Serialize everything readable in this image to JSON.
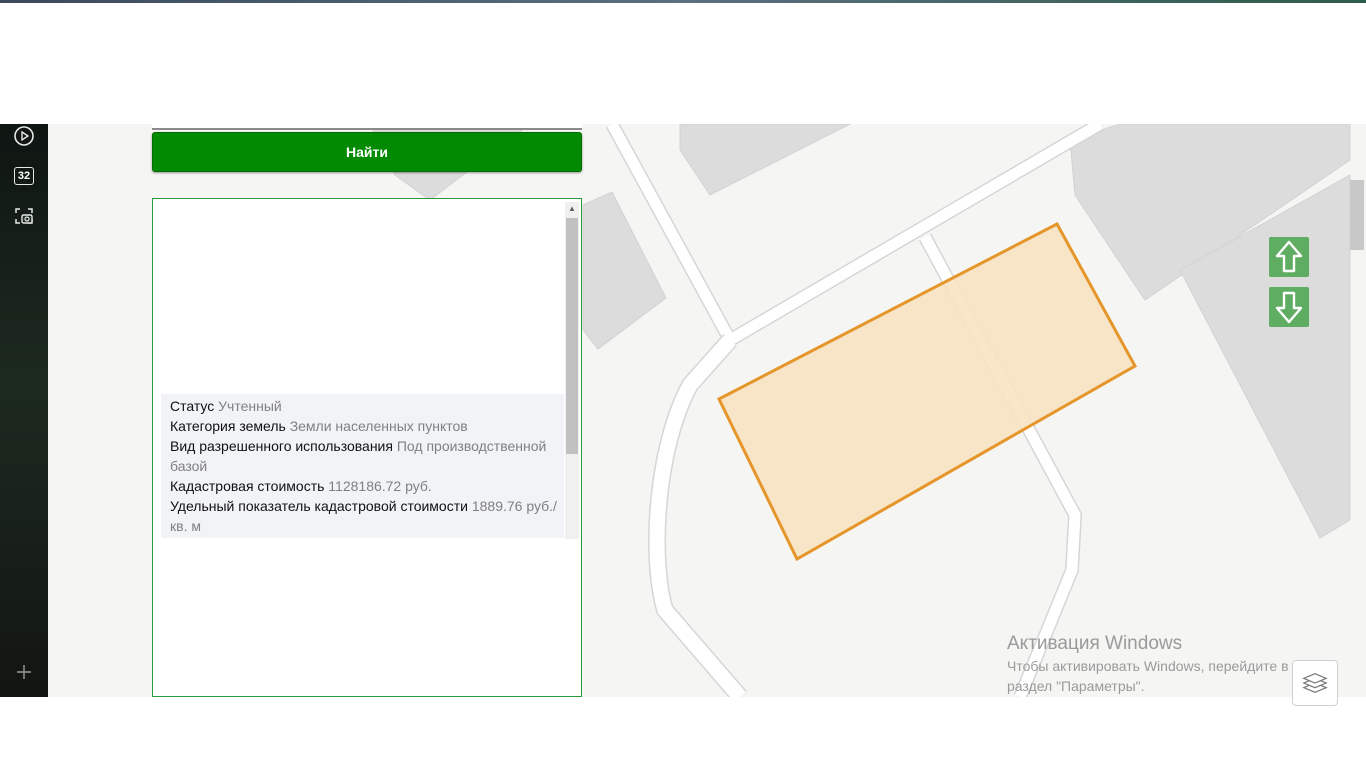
{
  "search": {
    "button_label": "Найти"
  },
  "sidebar": {
    "items": [
      {
        "icon": "play-circle-icon"
      },
      {
        "icon": "badge-number-icon",
        "label": "32"
      },
      {
        "icon": "screenshot-camera-icon"
      },
      {
        "icon": "plus-icon"
      }
    ]
  },
  "info": {
    "rows": [
      {
        "label": "Статус",
        "value": "Учтенный"
      },
      {
        "label": "Категория земель",
        "value": "Земли населенных пунктов"
      },
      {
        "label": "Вид разрешенного использования",
        "value": "Под производственной базой"
      },
      {
        "label": "Кадастровая стоимость",
        "value": "1128186.72 руб."
      },
      {
        "label": "Удельный показатель кадастровой стоимости",
        "value": "1889.76 руб./кв. м"
      }
    ]
  },
  "map": {
    "parcel_fill": "#f8e2c2",
    "parcel_stroke": "#e5962a",
    "building_color": "#dcdcdc",
    "road_color": "#ffffff",
    "background": "#f5f5f3",
    "controls": {
      "up_icon": "arrow-up-icon",
      "down_icon": "arrow-down-icon",
      "layers_icon": "layers-icon"
    }
  },
  "watermark": {
    "title": "Активация Windows",
    "subtitle": "Чтобы активировать Windows, перейдите в раздел \"Параметры\"."
  },
  "colors": {
    "accent_green": "#028a02",
    "panel_border": "#2a9a3a",
    "control_green": "#5fad62"
  }
}
